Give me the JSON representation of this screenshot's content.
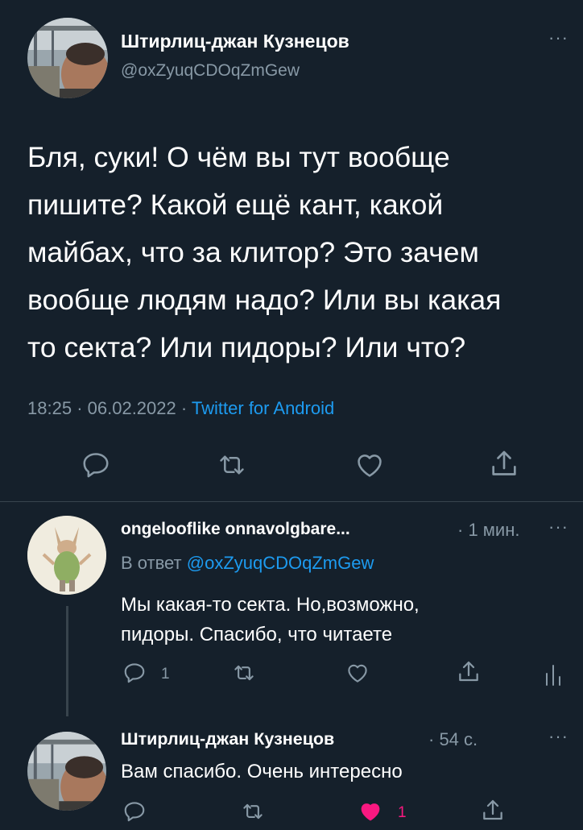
{
  "main_tweet": {
    "author_name": "Штирлиц-джан Кузнецов",
    "author_handle": "@oxZyuqCDOqZmGew",
    "text_lines": [
      "Бля, суки! О чём вы тут вообще",
      "пишите? Какой ещё кант, какой",
      "майбах, что за клитор? Это зачем",
      "вообще людям надо? Или вы какая",
      "то секта? Или пидоры? Или что?"
    ],
    "time": "18:25",
    "separator": "·",
    "date": "06.02.2022",
    "source": "Twitter for Android",
    "more_icon": "more-icon",
    "actions": [
      "reply-icon",
      "retweet-icon",
      "like-icon",
      "share-icon"
    ]
  },
  "reply_1": {
    "author_name": "ongelooflike onnavolgbare...",
    "time": "· 1 мин.",
    "reply_to_prefix": "В ответ",
    "reply_to_handle": "@oxZyuqCDOqZmGew",
    "text_lines": [
      "Мы какая-то секта. Но,возможно,",
      "пидоры. Спасибо, что читаете"
    ],
    "reply_count": "1",
    "actions": [
      "reply-icon",
      "retweet-icon",
      "like-icon",
      "share-icon",
      "analytics-icon"
    ]
  },
  "reply_2": {
    "author_name": "Штирлиц-джан Кузнецов",
    "time": "· 54 с.",
    "text": "Вам спасибо. Очень интересно",
    "like_count": "1",
    "actions": [
      "reply-icon",
      "retweet-icon",
      "like-filled-icon",
      "share-icon"
    ]
  },
  "colors": {
    "background": "#15202b",
    "muted": "#8899a6",
    "link": "#1d9bf0",
    "like_active": "#f91880",
    "divider": "#38444d"
  }
}
